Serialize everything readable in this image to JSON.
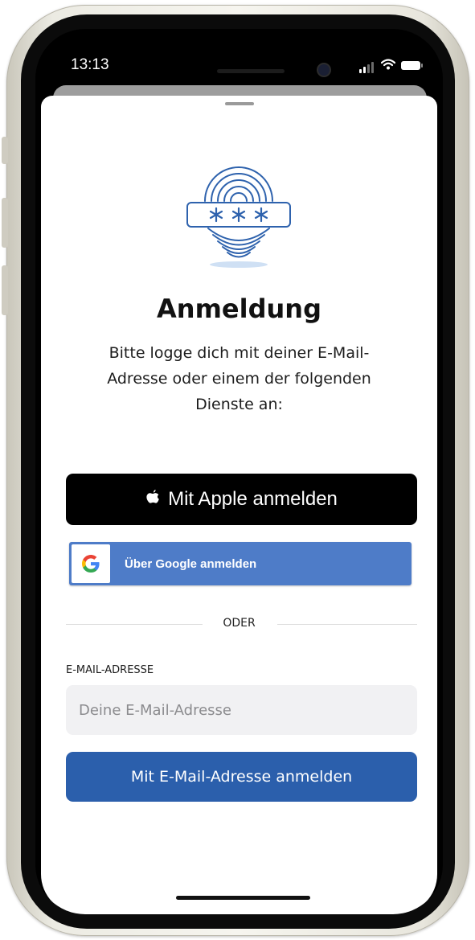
{
  "status_bar": {
    "time": "13:13",
    "icons": [
      "cellular-signal-icon",
      "wifi-icon",
      "battery-icon"
    ]
  },
  "login_sheet": {
    "illustration": "fingerprint-password-icon",
    "title": "Anmeldung",
    "subtitle": "Bitte logge dich mit deiner E-Mail-Adresse oder einem der folgenden Dienste an:",
    "apple_button": {
      "icon": "apple-logo-icon",
      "label": "Mit Apple anmelden"
    },
    "google_button": {
      "icon": "google-g-icon",
      "label": "Über Google anmelden"
    },
    "divider_text": "ODER",
    "email": {
      "label": "E-MAIL-ADRESSE",
      "placeholder": "Deine E-Mail-Adresse",
      "value": ""
    },
    "email_button": {
      "label": "Mit E-Mail-Adresse anmelden"
    }
  },
  "colors": {
    "apple_button_bg": "#000000",
    "google_button_bg": "#4e7cc8",
    "email_button_bg": "#2b5fac",
    "input_bg": "#f1f1f3",
    "illustration_stroke": "#2e62ad"
  }
}
